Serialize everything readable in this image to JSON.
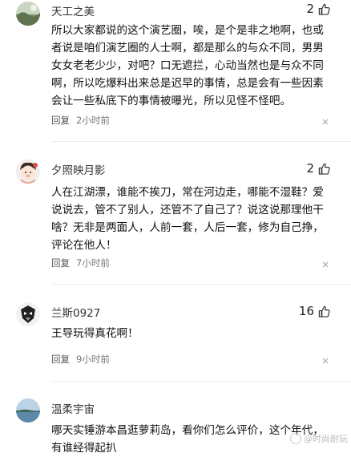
{
  "comments": [
    {
      "username": "天工之美",
      "likes": "2",
      "text": "所以大家都说的这个演艺圈，唉，是个是非之地啊，也或者说是咱们演艺圈的人士啊，都是那么的与众不同，男男女女老老少少，对吧？口无遮拦，心动当然也是与众不同啊，所以吃爆料出来总是迟早的事情，总是会有一些因素会让一些私底下的事情被曝光，所以见怪不怪吧。",
      "reply_label": "回复",
      "time": "2小时前"
    },
    {
      "username": "夕照映月影",
      "likes": "2",
      "text": "人在江湖漂，谁能不挨刀，常在河边走，哪能不湿鞋？爱说说去，管不了别人，还管不了自己了？说这说那理他干啥？无非是两面人，人前一套，人后一套，修为自己挣，评论在他人！",
      "reply_label": "回复",
      "time": "7小时前"
    },
    {
      "username": "兰斯0927",
      "likes": "16",
      "text": "王导玩得真花啊！",
      "reply_label": "回复",
      "time": "9小时前"
    },
    {
      "username": "温柔宇宙",
      "likes": "",
      "text": "哪天实锤游本昌逛萝莉岛，看你们怎么评价，这个年代，有谁经得起扒",
      "reply_label": "",
      "time": ""
    }
  ],
  "watermark": "@时尚耐玩",
  "icons": {
    "like": "thumbs-up-icon",
    "close": "close-icon"
  }
}
